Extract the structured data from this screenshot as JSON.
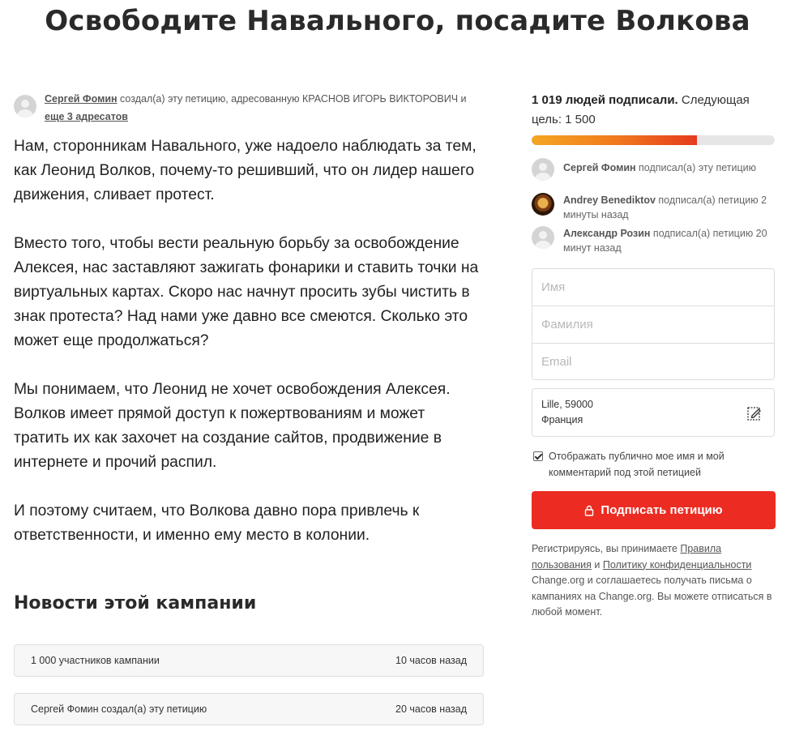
{
  "page": {
    "title": "Освободите Навального, посадите Волкова"
  },
  "creator": {
    "name": "Сергей Фомин",
    "text_created": " создал(а) эту петицию, адресованную ",
    "addressee": "КРАСНОВ ИГОРЬ ВИКТОРОВИЧ",
    "text_and": " и ",
    "more_link": "еще 3 адресатов"
  },
  "story": {
    "paragraphs": [
      "Нам, сторонникам Навального, уже надоело наблюдать за тем, как Леонид Волков, почему-то решивший, что он лидер нашего движения, сливает протест.",
      "Вместо того, чтобы вести реальную борьбу за освобождение Алексея, нас заставляют зажигать фонарики и ставить точки на виртуальных картах. Скоро нас начнут просить зубы чистить в знак протеста? Над нами уже давно все смеются. Сколько это может еще продолжаться?",
      "Мы понимаем, что Леонид не хочет освобождения Алексея. Волков имеет прямой доступ к пожертвованиям и может тратить их как захочет на создание сайтов, продвижение в интернете и прочий распил.",
      "И поэтому считаем, что Волкова давно пора привлечь к ответственности, и именно ему место в колонии."
    ]
  },
  "news": {
    "title": "Новости этой кампании",
    "items": [
      {
        "label": "1 000 участников кампании",
        "time": "10 часов назад"
      },
      {
        "label": "Сергей Фомин создал(а) эту петицию",
        "time": "20 часов назад"
      }
    ]
  },
  "signatures": {
    "count_bold": "1 019 людей подписали.",
    "count_rest": " Следующая цель: 1 500",
    "progress_fraction": 0.679,
    "recent": [
      {
        "name": "Сергей Фомин",
        "action": " подписал(а) эту петицию",
        "avatar": "person-placeholder-icon"
      },
      {
        "name": "Andrey Benediktov",
        "action": " подписал(а) петицию 2 минуты назад",
        "avatar": "user-photo"
      },
      {
        "name": "Александр Розин",
        "action": " подписал(а) петицию 20 минут назад",
        "avatar": "person-placeholder-icon"
      }
    ]
  },
  "form": {
    "first_name_placeholder": "Имя",
    "last_name_placeholder": "Фамилия",
    "email_placeholder": "Email",
    "location_line1": "Lille, 59000",
    "location_line2": "Франция",
    "consent_label": "Отображать публично мое имя и мой комментарий под этой петицией",
    "consent_checked": true,
    "sign_button": "Подписать петицию"
  },
  "terms": {
    "prefix": "Регистрируясь, вы принимаете ",
    "link1": "Правила пользования",
    "and": " и ",
    "link2": "Политику конфиденциальности",
    "suffix": " Change.org и соглашаетесь получать письма о кампаниях на Change.org. Вы можете отписаться в любой момент."
  },
  "colors": {
    "accent": "#ec2c22",
    "progress_start": "#f5a623",
    "progress_end": "#e53a1e"
  }
}
